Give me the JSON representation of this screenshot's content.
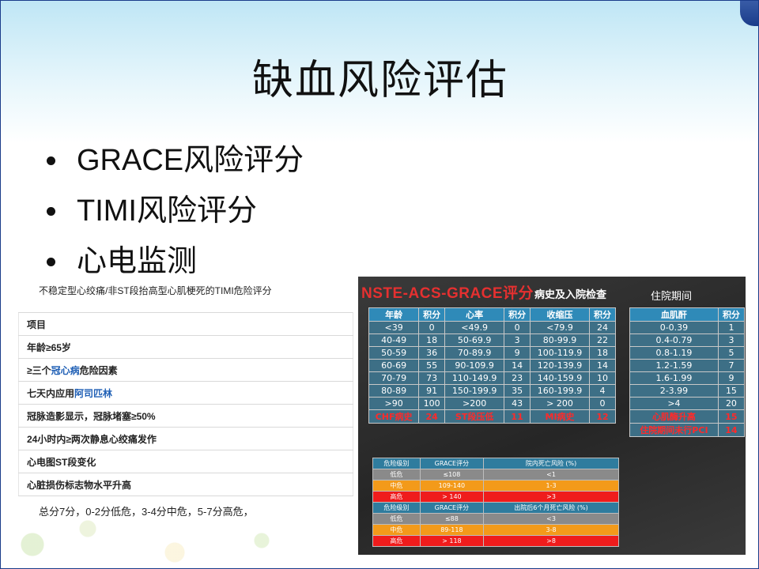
{
  "slide": {
    "title": "缺血风险评估",
    "bullets": [
      "GRACE风险评分",
      "TIMI风险评分",
      "心电监测"
    ]
  },
  "timi": {
    "caption": "不稳定型心绞痛/非ST段抬高型心肌梗死的TIMI危险评分",
    "rows": [
      {
        "text": "项目"
      },
      {
        "text": "年龄≥65岁"
      },
      {
        "pre": "≥三个",
        "link": "冠心病",
        "post": "危险因素"
      },
      {
        "pre": "七天内应用",
        "link": "阿司匹林",
        "post": ""
      },
      {
        "text": "冠脉造影显示，冠脉堵塞≥50%"
      },
      {
        "text": "24小时内≥两次静息心绞痛发作"
      },
      {
        "text": "心电图ST段变化"
      },
      {
        "text": "心脏损伤标志物水平升高"
      }
    ],
    "footer": "总分7分，0-2分低危，3-4分中危，5-7分高危，"
  },
  "grace": {
    "title": "NSTE-ACS-GRACE评分",
    "subtitle": "病史及入院检查",
    "subtitle2": "住院期间",
    "history_header": [
      "年龄",
      "积分",
      "心率",
      "积分",
      "收缩压",
      "积分"
    ],
    "history_rows": [
      [
        "<39",
        "0",
        "<49.9",
        "0",
        "<79.9",
        "24"
      ],
      [
        "40-49",
        "18",
        "50-69.9",
        "3",
        "80-99.9",
        "22"
      ],
      [
        "50-59",
        "36",
        "70-89.9",
        "9",
        "100-119.9",
        "18"
      ],
      [
        "60-69",
        "55",
        "90-109.9",
        "14",
        "120-139.9",
        "14"
      ],
      [
        "70-79",
        "73",
        "110-149.9",
        "23",
        "140-159.9",
        "10"
      ],
      [
        "80-89",
        "91",
        "150-199.9",
        "35",
        "160-199.9",
        "4"
      ],
      [
        ">90",
        "100",
        ">200",
        "43",
        "> 200",
        "0"
      ]
    ],
    "history_red_row": [
      "CHF病史",
      "24",
      "ST段压低",
      "11",
      "MI病史",
      "12"
    ],
    "hosp_header": [
      "血肌酐",
      "积分"
    ],
    "hosp_rows": [
      [
        "0-0.39",
        "1"
      ],
      [
        "0.4-0.79",
        "3"
      ],
      [
        "0.8-1.19",
        "5"
      ],
      [
        "1.2-1.59",
        "7"
      ],
      [
        "1.6-1.99",
        "9"
      ],
      [
        "2-3.99",
        "15"
      ],
      [
        ">4",
        "20"
      ]
    ],
    "hosp_red_rows": [
      [
        "心肌酶升高",
        "15"
      ],
      [
        "住院期间未行PCI",
        "14"
      ]
    ],
    "risk1": {
      "header": [
        "危险级别",
        "GRACE评分",
        "院内死亡风险 (%)"
      ],
      "rows": [
        {
          "level": "low",
          "cells": [
            "低危",
            "≤108",
            "<1"
          ]
        },
        {
          "level": "mid",
          "cells": [
            "中危",
            "109-140",
            "1-3"
          ]
        },
        {
          "level": "high",
          "cells": [
            "高危",
            "> 140",
            ">3"
          ]
        }
      ]
    },
    "risk2": {
      "header": [
        "危险级别",
        "GRACE评分",
        "出院后6个月死亡风险 (%)"
      ],
      "rows": [
        {
          "level": "low",
          "cells": [
            "低危",
            "≤88",
            "<3"
          ]
        },
        {
          "level": "mid",
          "cells": [
            "中危",
            "89-118",
            "3-8"
          ]
        },
        {
          "level": "high",
          "cells": [
            "高危",
            "> 118",
            ">8"
          ]
        }
      ]
    }
  }
}
